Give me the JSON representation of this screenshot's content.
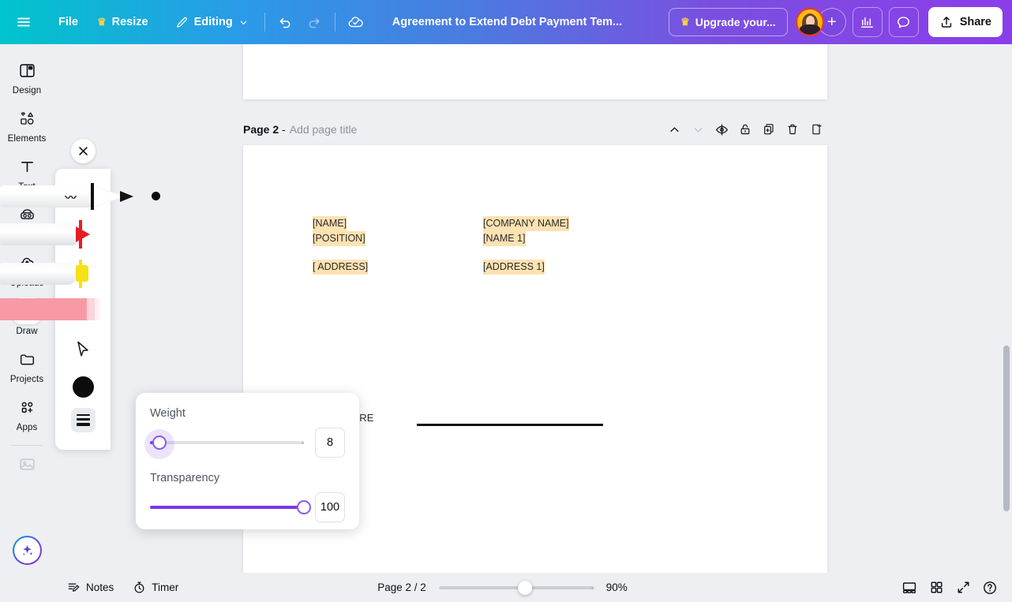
{
  "topbar": {
    "menu_icon": "hamburger-icon",
    "file_label": "File",
    "resize_label": "Resize",
    "resize_crown": "♛",
    "editing_label": "Editing",
    "undo_icon": "undo-icon",
    "redo_icon": "redo-icon",
    "cloud_icon": "cloud-saved-icon",
    "doc_title": "Agreement to Extend Debt Payment Tem...",
    "upgrade_label": "Upgrade your...",
    "upgrade_crown": "♛",
    "avatar_name": "user-avatar",
    "plus_label": "+",
    "insights_icon": "bar-chart-icon",
    "comment_icon": "speech-bubble-icon",
    "share_label": "Share"
  },
  "sidebar": {
    "items": [
      {
        "label": "Design",
        "icon": "layout-panel-icon",
        "active": false,
        "pro": false
      },
      {
        "label": "Elements",
        "icon": "shapes-icon",
        "active": false,
        "pro": false
      },
      {
        "label": "Text",
        "icon": "text-t-icon",
        "active": false,
        "pro": false
      },
      {
        "label": "Brand",
        "icon": "brand-kit-icon",
        "active": false,
        "pro": true
      },
      {
        "label": "Uploads",
        "icon": "cloud-upload-icon",
        "active": false,
        "pro": false
      },
      {
        "label": "Draw",
        "icon": "pen-draw-icon",
        "active": true,
        "pro": false
      },
      {
        "label": "Projects",
        "icon": "folder-icon",
        "active": false,
        "pro": false
      },
      {
        "label": "Apps",
        "icon": "apps-grid-icon",
        "active": false,
        "pro": false
      }
    ],
    "image_tool_icon": "image-placeholder-icon",
    "magic_button_icon": "magic-sparkle-icon"
  },
  "draw_panel": {
    "close_icon": "close-icon",
    "tools": [
      {
        "name": "pen",
        "label": "Pen",
        "selected": true,
        "color": "#0c0c0c"
      },
      {
        "name": "marker",
        "label": "Marker",
        "selected": false,
        "color": "#e81c24"
      },
      {
        "name": "highlighter",
        "label": "Highlighter",
        "selected": false,
        "color": "#f7e016"
      },
      {
        "name": "magic-highlighter",
        "label": "Highlighter bar",
        "selected": false,
        "color": "#f79aa6"
      },
      {
        "name": "cursor",
        "label": "Select",
        "selected": false,
        "color": "#0d1216"
      }
    ],
    "color_swatch": "#0c0c0c",
    "weight_button_icon": "line-weight-icon"
  },
  "popover": {
    "weight_label": "Weight",
    "weight_value": "8",
    "weight_percent": 6,
    "transparency_label": "Transparency",
    "transparency_value": "100",
    "transparency_percent": 100,
    "accent_color": "#7b37e8"
  },
  "page_header": {
    "page_label": "Page 2",
    "dash": "-",
    "title_placeholder": "Add page title",
    "actions": [
      {
        "name": "move-page-up-button",
        "icon": "chevron-up-icon",
        "disabled": false
      },
      {
        "name": "move-page-down-button",
        "icon": "chevron-down-icon",
        "disabled": true
      },
      {
        "name": "hide-page-button",
        "icon": "eye-slash-icon",
        "disabled": false
      },
      {
        "name": "lock-page-button",
        "icon": "lock-icon",
        "disabled": false
      },
      {
        "name": "duplicate-page-button",
        "icon": "duplicate-icon",
        "disabled": false
      },
      {
        "name": "delete-page-button",
        "icon": "trash-icon",
        "disabled": false
      },
      {
        "name": "add-page-button",
        "icon": "add-page-icon",
        "disabled": false
      }
    ]
  },
  "document": {
    "left_block": [
      "[NAME]",
      "[POSITION]"
    ],
    "left_address": "[ ADDRESS]",
    "right_block": [
      "[COMPANY NAME]",
      "[NAME 1]"
    ],
    "right_address": "[ADDRESS 1]",
    "signature_label": "SIGNATURE",
    "highlight_color": "#fde2b2"
  },
  "bottombar": {
    "notes_label": "Notes",
    "notes_icon": "notes-icon",
    "timer_label": "Timer",
    "timer_icon": "timer-icon",
    "page_count": "Page 2 / 2",
    "zoom_value": "90%",
    "zoom_percent": 56,
    "right_icons": [
      {
        "name": "presentation-view-button",
        "icon": "presentation-icon"
      },
      {
        "name": "grid-view-button",
        "icon": "grid-view-icon"
      },
      {
        "name": "fullscreen-button",
        "icon": "expand-arrows-icon"
      },
      {
        "name": "help-button",
        "icon": "question-mark-icon"
      }
    ]
  }
}
